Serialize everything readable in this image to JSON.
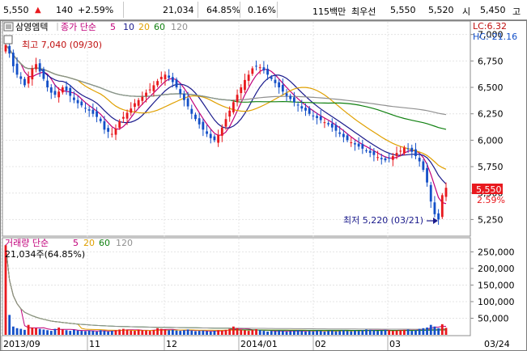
{
  "header": {
    "price": "5,550",
    "arrow": "▲",
    "change": "140",
    "change_pct": "+2.59%",
    "volume": "21,034",
    "volume_ratio": "64.85%",
    "turnover": "0.16%",
    "amount": "115백만",
    "best_bid_label": "최우선",
    "ask": "5,550",
    "bid": "5,520",
    "open_label": "시",
    "open": "5,450",
    "high_label": "고"
  },
  "price_panel": {
    "name": "삼영엠텍",
    "legend_label": "종가 단순",
    "ma_labels": [
      "5",
      "10",
      "20",
      "60",
      "120"
    ],
    "ma_colors": [
      "#c0007a",
      "#1a1a8c",
      "#e0a000",
      "#108010",
      "#909090"
    ],
    "lc_label": "LC:6.32",
    "hc_label": "HC:-21.16",
    "high_note": "최고 7,040 (09/30)",
    "low_note": "최저 5,220 (03/21)",
    "last_price_tag": "5,550",
    "last_pct_tag": "2.59%"
  },
  "volume_panel": {
    "legend_label": "거래량 단순",
    "ma_labels": [
      "5",
      "20",
      "60",
      "120"
    ],
    "ma_colors": [
      "#c0007a",
      "#e0a000",
      "#108010",
      "#909090"
    ],
    "volume_note": "21,034주(64.85%)"
  },
  "x_axis_labels": [
    "2013/09",
    "11",
    "12",
    "2014/01",
    "02",
    "03",
    "03/24"
  ],
  "colors": {
    "up": "#e8191e",
    "down": "#1450c8",
    "tag_bg": "#e8191e"
  },
  "chart_data": {
    "type": "candlestick",
    "price_axis": {
      "ticks": [
        5250,
        5500,
        5750,
        6000,
        6250,
        6500,
        6750,
        7000
      ],
      "ylim": [
        5100,
        7120
      ]
    },
    "volume_axis": {
      "ticks": [
        50000,
        100000,
        150000,
        200000,
        250000
      ],
      "ylim": [
        0,
        290000
      ]
    },
    "close": [
      6900,
      6820,
      6700,
      6620,
      6580,
      6520,
      6600,
      6680,
      6720,
      6650,
      6580,
      6500,
      6450,
      6430,
      6460,
      6500,
      6470,
      6420,
      6380,
      6350,
      6330,
      6300,
      6280,
      6250,
      6220,
      6180,
      6100,
      6080,
      6060,
      6110,
      6180,
      6220,
      6260,
      6300,
      6350,
      6380,
      6410,
      6450,
      6480,
      6520,
      6560,
      6600,
      6620,
      6590,
      6550,
      6500,
      6440,
      6380,
      6320,
      6250,
      6200,
      6150,
      6100,
      6060,
      6020,
      6000,
      6050,
      6120,
      6200,
      6280,
      6360,
      6430,
      6500,
      6570,
      6620,
      6680,
      6700,
      6690,
      6660,
      6620,
      6580,
      6540,
      6500,
      6460,
      6420,
      6390,
      6360,
      6330,
      6300,
      6280,
      6250,
      6230,
      6210,
      6190,
      6170,
      6150,
      6120,
      6090,
      6060,
      6030,
      6000,
      5980,
      5960,
      5940,
      5920,
      5900,
      5880,
      5860,
      5840,
      5820,
      5810,
      5830,
      5850,
      5880,
      5900,
      5930,
      5920,
      5890,
      5850,
      5800,
      5720,
      5600,
      5420,
      5300,
      5250,
      5480,
      5550
    ],
    "volume": [
      270000,
      60000,
      25000,
      20000,
      18000,
      15000,
      30000,
      22000,
      20000,
      18000,
      16000,
      14000,
      12000,
      18000,
      22000,
      16000,
      14000,
      12000,
      15000,
      13000,
      12000,
      11000,
      13000,
      12000,
      10000,
      14000,
      12000,
      10000,
      12000,
      14000,
      16000,
      18000,
      15000,
      13000,
      12000,
      16000,
      14000,
      13000,
      12000,
      15000,
      20000,
      18000,
      16000,
      14000,
      15000,
      13000,
      12000,
      14000,
      16000,
      13000,
      11000,
      12000,
      13000,
      11000,
      10000,
      12000,
      14000,
      13000,
      15000,
      18000,
      25000,
      20000,
      16000,
      14000,
      12000,
      15000,
      17000,
      14000,
      12000,
      10000,
      12000,
      11000,
      13000,
      12000,
      10000,
      11000,
      12000,
      14000,
      12000,
      10000,
      12000,
      11000,
      13000,
      12000,
      10000,
      12000,
      13000,
      11000,
      12000,
      14000,
      12000,
      11000,
      13000,
      12000,
      14000,
      16000,
      15000,
      14000,
      12000,
      13000,
      15000,
      14000,
      12000,
      13000,
      14000,
      15000,
      16000,
      12000,
      14000,
      18000,
      20000,
      22000,
      30000,
      25000,
      20000,
      32000,
      21034
    ]
  }
}
